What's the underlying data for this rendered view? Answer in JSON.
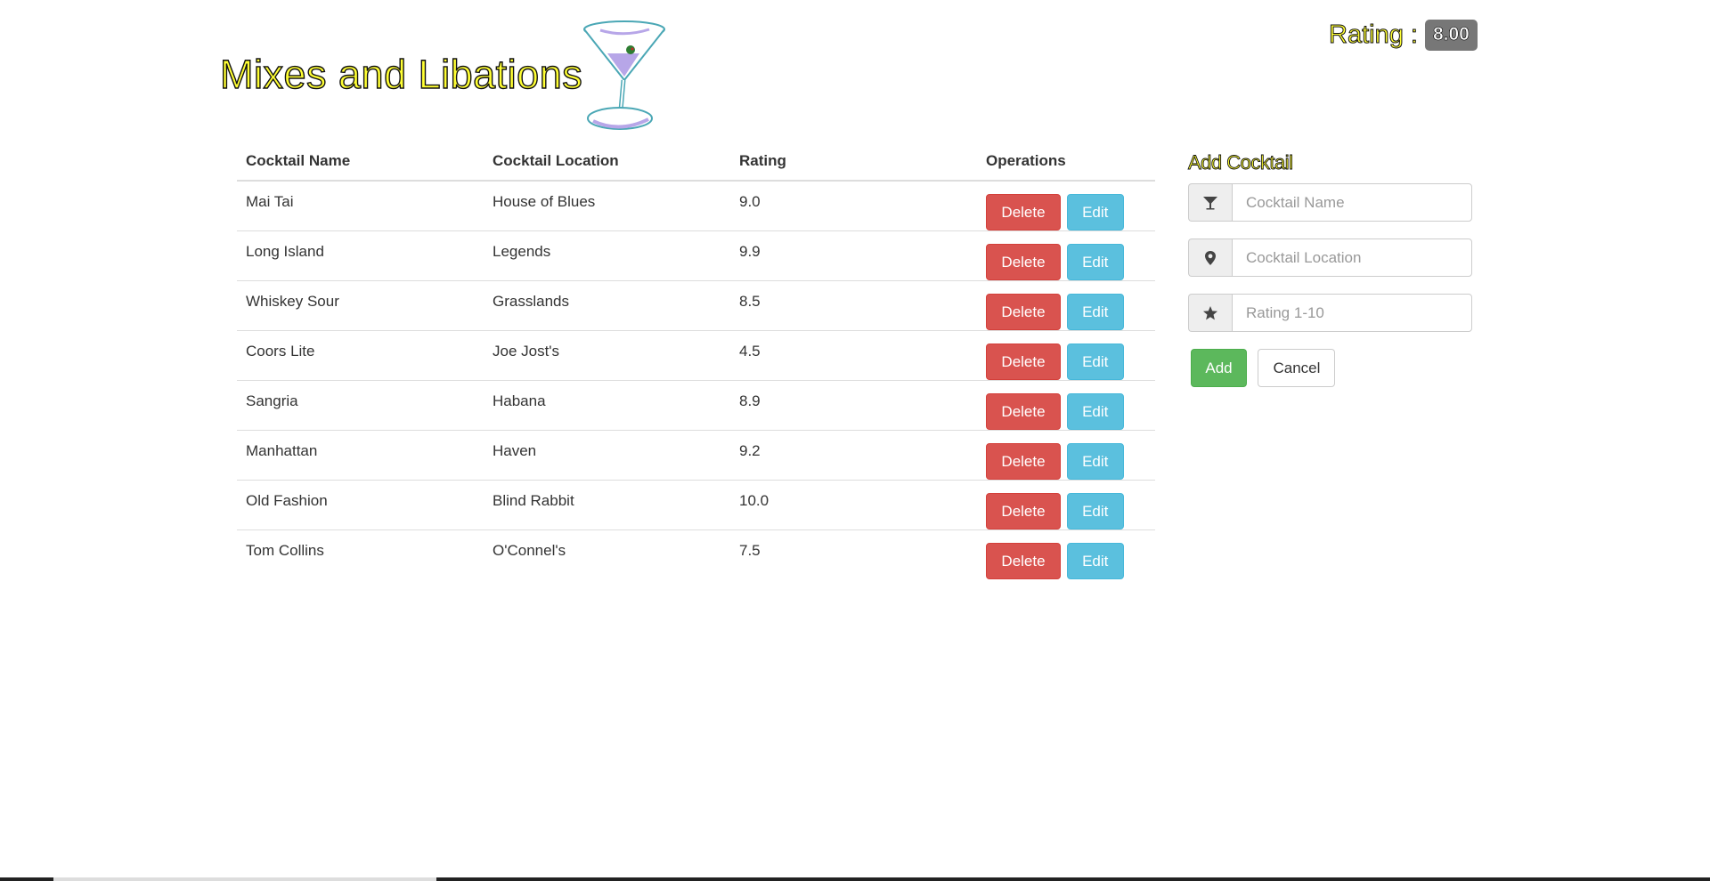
{
  "header": {
    "title": "Mixes and Libations",
    "rating_label": "Rating :",
    "rating_value": "8.00"
  },
  "table": {
    "columns": [
      "Cocktail Name",
      "Cocktail Location",
      "Rating",
      "Operations"
    ],
    "rows": [
      {
        "name": "Mai Tai",
        "location": "House of Blues",
        "rating": "9.0"
      },
      {
        "name": "Long Island",
        "location": "Legends",
        "rating": "9.9"
      },
      {
        "name": "Whiskey Sour",
        "location": "Grasslands",
        "rating": "8.5"
      },
      {
        "name": "Coors Lite",
        "location": "Joe Jost's",
        "rating": "4.5"
      },
      {
        "name": "Sangria",
        "location": "Habana",
        "rating": "8.9"
      },
      {
        "name": "Manhattan",
        "location": "Haven",
        "rating": "9.2"
      },
      {
        "name": "Old Fashion",
        "location": "Blind Rabbit",
        "rating": "10.0"
      },
      {
        "name": "Tom Collins",
        "location": "O'Connel's",
        "rating": "7.5"
      }
    ],
    "delete_label": "Delete",
    "edit_label": "Edit"
  },
  "form": {
    "title": "Add Cocktail",
    "name_placeholder": "Cocktail Name",
    "location_placeholder": "Cocktail Location",
    "rating_placeholder": "Rating 1-10",
    "name_icon": "cocktail-glass-icon",
    "location_icon": "map-marker-icon",
    "rating_icon": "star-icon",
    "add_label": "Add",
    "cancel_label": "Cancel"
  },
  "colors": {
    "title_fill": "#ffff33",
    "delete": "#d9534f",
    "edit": "#5bc0de",
    "add": "#5cb85c",
    "badge": "#777777"
  }
}
